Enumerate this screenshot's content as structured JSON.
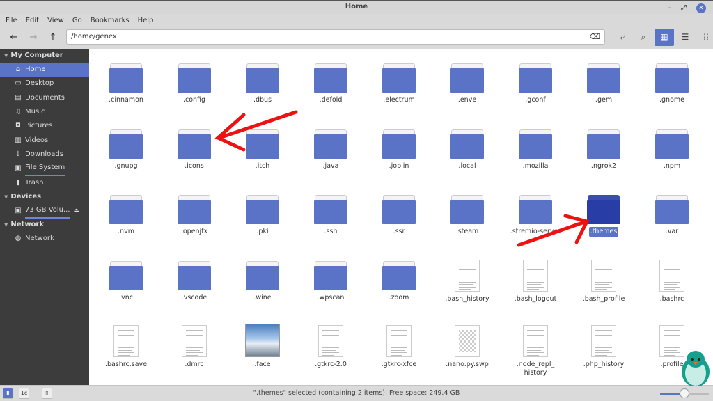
{
  "window": {
    "title": "Home",
    "controls": {
      "minimize": "–",
      "maximize": "⤢",
      "close": "✕"
    }
  },
  "menu": [
    "File",
    "Edit",
    "View",
    "Go",
    "Bookmarks",
    "Help"
  ],
  "toolbar": {
    "path": "/home/genex",
    "back": "←",
    "forward": "→",
    "up": "↑",
    "clear": "⌫"
  },
  "sidebar": {
    "sections": [
      {
        "title": "My Computer",
        "items": [
          {
            "label": "Home",
            "icon": "home-icon",
            "glyph": "⌂",
            "selected": true
          },
          {
            "label": "Desktop",
            "icon": "desktop-icon",
            "glyph": "▭"
          },
          {
            "label": "Documents",
            "icon": "document-icon",
            "glyph": "▤"
          },
          {
            "label": "Music",
            "icon": "music-icon",
            "glyph": "♫"
          },
          {
            "label": "Pictures",
            "icon": "camera-icon",
            "glyph": "◘"
          },
          {
            "label": "Videos",
            "icon": "film-icon",
            "glyph": "▥"
          },
          {
            "label": "Downloads",
            "icon": "download-icon",
            "glyph": "↓"
          },
          {
            "label": "File System",
            "icon": "drive-icon",
            "glyph": "▣",
            "underline": true
          },
          {
            "label": "Trash",
            "icon": "trash-icon",
            "glyph": "▮"
          }
        ]
      },
      {
        "title": "Devices",
        "items": [
          {
            "label": "73 GB Volu...",
            "icon": "drive-icon",
            "glyph": "▣",
            "underline": true,
            "eject": "⏏"
          }
        ]
      },
      {
        "title": "Network",
        "items": [
          {
            "label": "Network",
            "icon": "globe-icon",
            "glyph": "◍"
          }
        ]
      }
    ]
  },
  "files": [
    {
      "name": ".cinnamon",
      "type": "folder"
    },
    {
      "name": ".config",
      "type": "folder"
    },
    {
      "name": ".dbus",
      "type": "folder"
    },
    {
      "name": ".defold",
      "type": "folder"
    },
    {
      "name": ".electrum",
      "type": "folder"
    },
    {
      "name": ".enve",
      "type": "folder"
    },
    {
      "name": ".gconf",
      "type": "folder"
    },
    {
      "name": ".gem",
      "type": "folder"
    },
    {
      "name": ".gnome",
      "type": "folder"
    },
    {
      "name": ".gnupg",
      "type": "folder"
    },
    {
      "name": ".icons",
      "type": "folder"
    },
    {
      "name": ".itch",
      "type": "folder"
    },
    {
      "name": ".java",
      "type": "folder"
    },
    {
      "name": ".joplin",
      "type": "folder"
    },
    {
      "name": ".local",
      "type": "folder"
    },
    {
      "name": ".mozilla",
      "type": "folder"
    },
    {
      "name": ".ngrok2",
      "type": "folder"
    },
    {
      "name": ".npm",
      "type": "folder"
    },
    {
      "name": ".nvm",
      "type": "folder"
    },
    {
      "name": ".openjfx",
      "type": "folder"
    },
    {
      "name": ".pki",
      "type": "folder"
    },
    {
      "name": ".ssh",
      "type": "folder"
    },
    {
      "name": ".ssr",
      "type": "folder"
    },
    {
      "name": ".steam",
      "type": "folder"
    },
    {
      "name": ".stremio-server",
      "type": "folder"
    },
    {
      "name": ".themes",
      "type": "folder",
      "selected": true
    },
    {
      "name": ".var",
      "type": "folder"
    },
    {
      "name": ".vnc",
      "type": "folder"
    },
    {
      "name": ".vscode",
      "type": "folder"
    },
    {
      "name": ".wine",
      "type": "folder"
    },
    {
      "name": ".wpscan",
      "type": "folder"
    },
    {
      "name": ".zoom",
      "type": "folder"
    },
    {
      "name": ".bash_history",
      "type": "text"
    },
    {
      "name": ".bash_logout",
      "type": "text"
    },
    {
      "name": ".bash_profile",
      "type": "text"
    },
    {
      "name": ".bashrc",
      "type": "text"
    },
    {
      "name": ".bashrc.save",
      "type": "text"
    },
    {
      "name": ".dmrc",
      "type": "text"
    },
    {
      "name": ".face",
      "type": "image"
    },
    {
      "name": ".gtkrc-2.0",
      "type": "text"
    },
    {
      "name": ".gtkrc-xfce",
      "type": "text"
    },
    {
      "name": ".nano.py.swp",
      "type": "swap"
    },
    {
      "name": ".node_repl_ history",
      "type": "text"
    },
    {
      "name": ".php_history",
      "type": "text"
    },
    {
      "name": ".profile",
      "type": "text"
    }
  ],
  "status": {
    "text": "\".themes\" selected (containing 2 items), Free space: 249.4 GB",
    "zoom_level": 0.5
  },
  "colors": {
    "accent": "#5b73c7",
    "annotation": "#ee1111"
  }
}
